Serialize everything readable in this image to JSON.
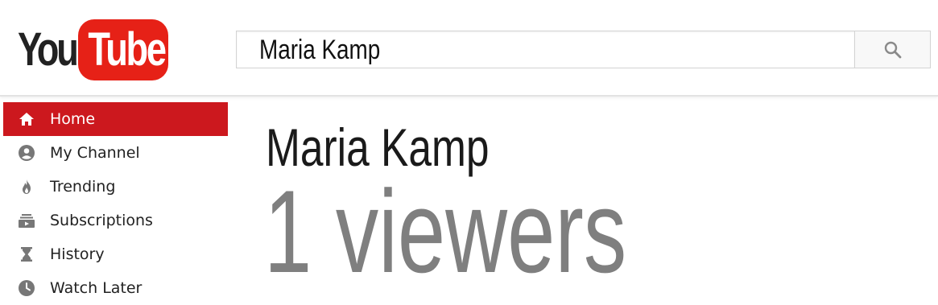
{
  "header": {
    "logo": {
      "you": "You",
      "tube": "Tube",
      "brand_color": "#e62117"
    },
    "search": {
      "value": "Maria Kamp",
      "button_icon": "search-icon"
    }
  },
  "sidebar": {
    "items": [
      {
        "label": "Home",
        "icon": "home-icon",
        "active": true
      },
      {
        "label": "My Channel",
        "icon": "account-icon",
        "active": false
      },
      {
        "label": "Trending",
        "icon": "flame-icon",
        "active": false
      },
      {
        "label": "Subscriptions",
        "icon": "subscriptions-icon",
        "active": false
      },
      {
        "label": "History",
        "icon": "hourglass-icon",
        "active": false
      },
      {
        "label": "Watch Later",
        "icon": "clock-icon",
        "active": false
      }
    ],
    "active_color": "#cc181e"
  },
  "main": {
    "name": "Maria Kamp",
    "viewers": "1 viewers"
  }
}
